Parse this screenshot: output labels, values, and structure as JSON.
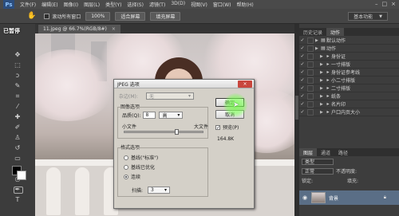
{
  "app": {
    "logo": "Ps"
  },
  "menus": [
    "文件(F)",
    "编辑(E)",
    "图像(I)",
    "图层(L)",
    "类型(Y)",
    "选择(S)",
    "滤镜(T)",
    "3D(D)",
    "视图(V)",
    "窗口(W)",
    "帮助(H)"
  ],
  "window_controls": [
    "–",
    "□",
    "×"
  ],
  "options_bar": {
    "tool_icon": "hand-icon",
    "scroll_all_label": "滚动所有窗口",
    "btn_100": "100%",
    "btn_fit": "适合屏幕",
    "btn_fill": "填充屏幕",
    "workspace": "基本功能"
  },
  "overlay": {
    "paused": "已暂停"
  },
  "document": {
    "tab_label": "11.jpeg @ 66.7%(RGB/8#)",
    "close": "×"
  },
  "dialog": {
    "title": "JPEG 选项",
    "close": "×",
    "matte_label": "杂边(M):",
    "matte_value": "无",
    "image_options": "图像选项",
    "quality_label": "品质(Q):",
    "quality_value": "8",
    "quality_preset": "高",
    "small_file": "小文件",
    "large_file": "大文件",
    "quality_fraction": 0.66,
    "format_options": "格式选项",
    "formats": [
      "基线(\"标准\")",
      "基线已优化",
      "连续"
    ],
    "selected_format_index": 2,
    "scans_label": "扫描:",
    "scans_value": "3",
    "ok": "确定",
    "cancel": "取消",
    "preview_label": "预览(P)",
    "preview_checked": true,
    "file_size": "164.8K"
  },
  "panel": {
    "tabs": [
      "历史记录",
      "动作"
    ],
    "active_tab": 1,
    "actions": [
      {
        "label": "默认动作",
        "level": 0,
        "type": "folder"
      },
      {
        "label": "动作",
        "level": 0,
        "type": "folder"
      },
      {
        "label": "身份证",
        "level": 1,
        "type": "action"
      },
      {
        "label": "一寸排版",
        "level": 1,
        "type": "action"
      },
      {
        "label": "身份证参考线",
        "level": 1,
        "type": "action"
      },
      {
        "label": "小二寸排版",
        "level": 1,
        "type": "action"
      },
      {
        "label": "二寸排版",
        "level": 1,
        "type": "action"
      },
      {
        "label": "纸条",
        "level": 1,
        "type": "action"
      },
      {
        "label": "名片印",
        "level": 1,
        "type": "action"
      },
      {
        "label": "户口内页大小",
        "level": 1,
        "type": "action"
      }
    ]
  },
  "layers": {
    "tabs": [
      "图层",
      "通道",
      "路径"
    ],
    "kind_label": "类型",
    "blend_mode": "正常",
    "opacity_label": "不透明度:",
    "lock_label": "锁定:",
    "fill_label": "填充:",
    "layer_name": "背景"
  }
}
